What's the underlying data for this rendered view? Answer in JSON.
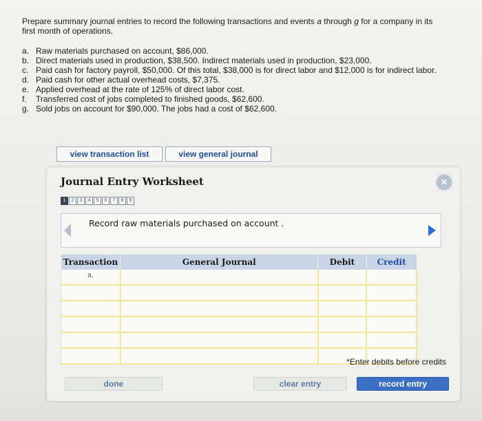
{
  "prompt": {
    "intro_prefix": "Prepare summary journal entries to record the following transactions and events ",
    "intro_a": "a",
    "intro_mid": " through ",
    "intro_g": "g",
    "intro_suffix": " for a company in its first month of operations."
  },
  "transactions": [
    {
      "letter": "a.",
      "text": "Raw materials purchased on account, $86,000."
    },
    {
      "letter": "b.",
      "text": "Direct materials used in production, $38,500. Indirect materials used in production, $23,000."
    },
    {
      "letter": "c.",
      "text": "Paid cash for factory payroll, $50,000. Of this total, $38,000 is for direct labor and $12,000 is for indirect labor."
    },
    {
      "letter": "d.",
      "text": "Paid cash for other actual overhead costs, $7,375."
    },
    {
      "letter": "e.",
      "text": "Applied overhead at the rate of 125% of direct labor cost."
    },
    {
      "letter": "f.",
      "text": "Transferred cost of jobs completed to finished goods, $62,600."
    },
    {
      "letter": "g.",
      "text": "Sold jobs on account for $90,000. The jobs had a cost of $62,600."
    }
  ],
  "top_buttons": {
    "view_transaction_list": "view transaction list",
    "view_general_journal": "view general journal"
  },
  "worksheet": {
    "title": "Journal Entry Worksheet",
    "close_label": "✕",
    "pages": [
      "1",
      "2",
      "3",
      "4",
      "5",
      "6",
      "7",
      "8",
      "9"
    ],
    "active_page": "1",
    "entry_description": "Record raw materials purchased on account .",
    "columns": {
      "transaction": "Transaction",
      "general_journal": "General Journal",
      "debit": "Debit",
      "credit": "Credit"
    },
    "rows": [
      {
        "transaction": "a."
      },
      {
        "transaction": ""
      },
      {
        "transaction": ""
      },
      {
        "transaction": ""
      },
      {
        "transaction": ""
      },
      {
        "transaction": ""
      }
    ],
    "note": "*Enter debits before credits",
    "buttons": {
      "done": "done",
      "clear_entry": "clear entry",
      "record_entry": "record entry"
    }
  },
  "colors": {
    "link_blue": "#1e4fa0",
    "header_bg": "#c9d5e6",
    "row_line": "#f3e796",
    "record_btn": "#3b6fc4"
  }
}
